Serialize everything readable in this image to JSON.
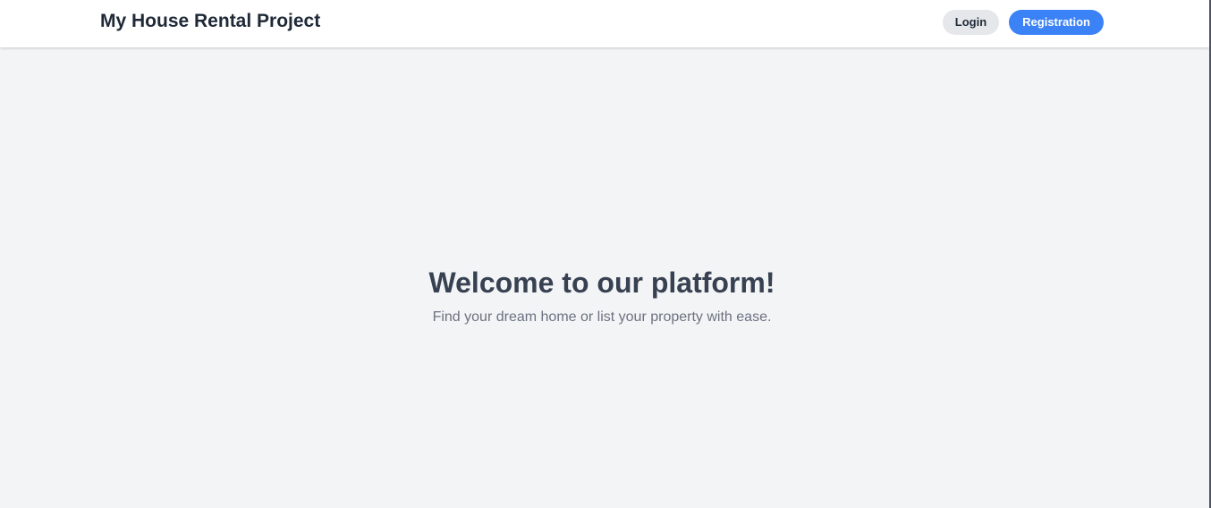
{
  "navbar": {
    "brand": "My House Rental Project",
    "login_label": "Login",
    "register_label": "Registration"
  },
  "hero": {
    "title": "Welcome to our platform!",
    "subtitle": "Find your dream home or list your property with ease."
  },
  "colors": {
    "page_background": "#f3f4f6",
    "navbar_background": "#ffffff",
    "accent": "#3b82f6",
    "login_button_background": "#e5e7eb",
    "heading_text": "#374151",
    "subtitle_text": "#6b7280"
  }
}
